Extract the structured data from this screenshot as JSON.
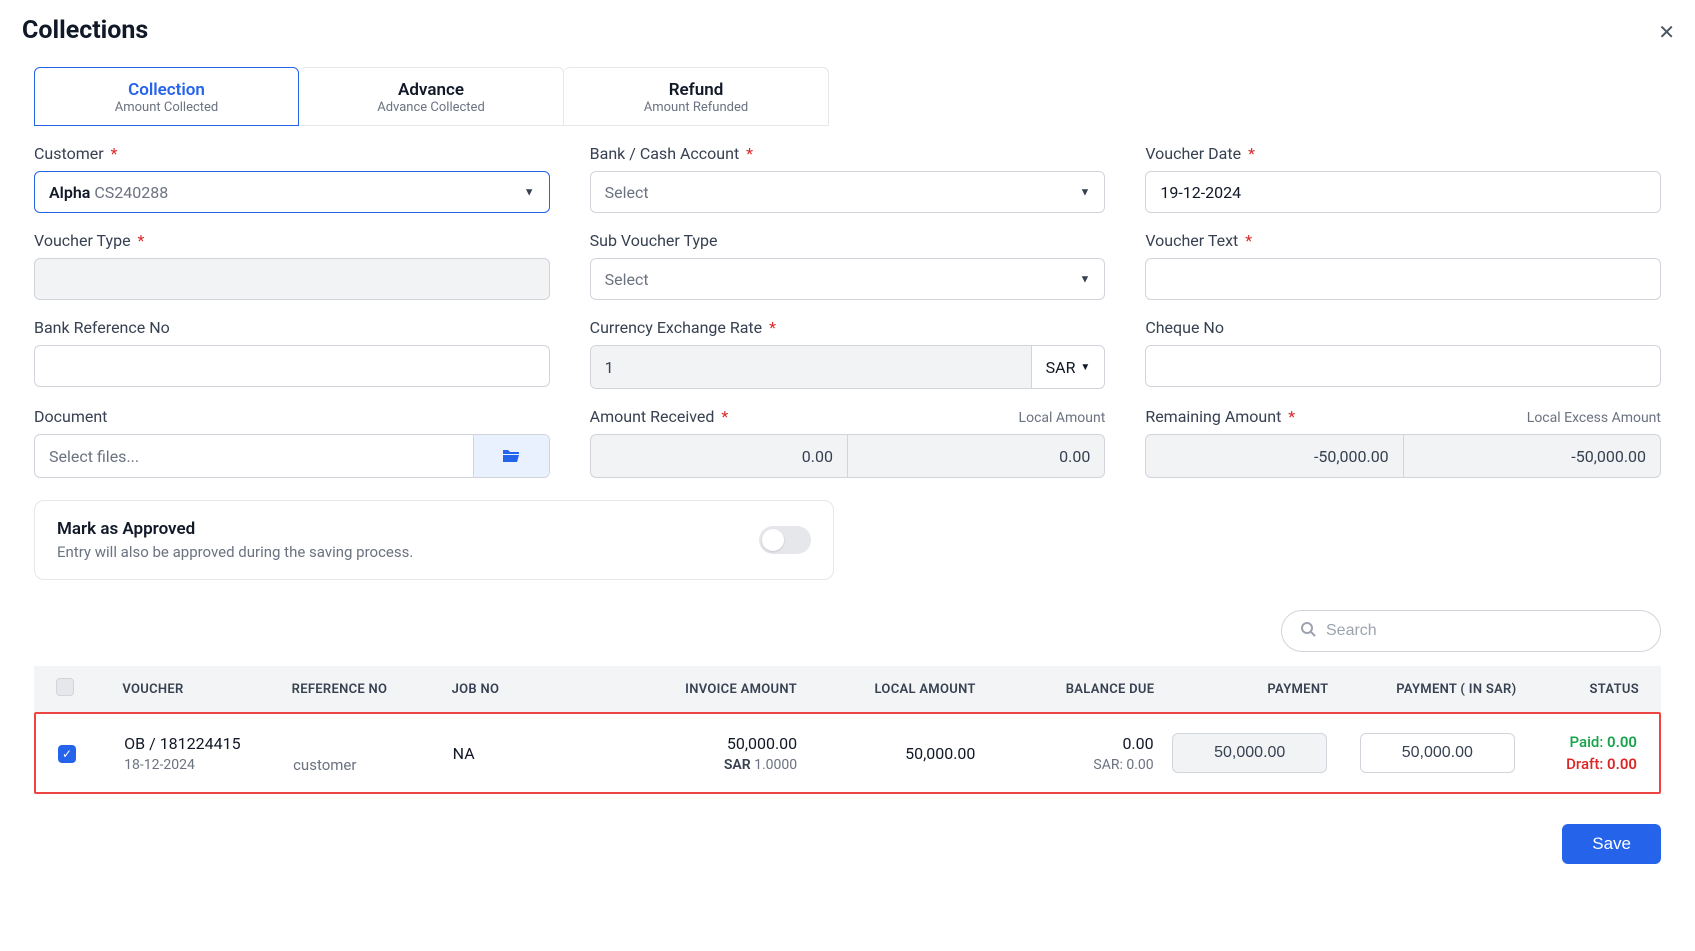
{
  "title": "Collections",
  "tabs": [
    {
      "title": "Collection",
      "sub": "Amount Collected"
    },
    {
      "title": "Advance",
      "sub": "Advance Collected"
    },
    {
      "title": "Refund",
      "sub": "Amount Refunded"
    }
  ],
  "form": {
    "customer": {
      "label": "Customer",
      "name": "Alpha",
      "code": "CS240288"
    },
    "bankAccount": {
      "label": "Bank / Cash Account",
      "placeholder": "Select"
    },
    "voucherDate": {
      "label": "Voucher Date",
      "value": "19-12-2024"
    },
    "voucherType": {
      "label": "Voucher Type"
    },
    "subVoucherType": {
      "label": "Sub Voucher Type",
      "placeholder": "Select"
    },
    "voucherText": {
      "label": "Voucher Text"
    },
    "bankRef": {
      "label": "Bank Reference No"
    },
    "currencyRate": {
      "label": "Currency Exchange Rate",
      "value": "1",
      "currency": "SAR"
    },
    "chequeNo": {
      "label": "Cheque No"
    },
    "document": {
      "label": "Document",
      "placeholder": "Select files..."
    },
    "amountReceived": {
      "label": "Amount Received",
      "labelRight": "Local Amount",
      "v1": "0.00",
      "v2": "0.00"
    },
    "remaining": {
      "label": "Remaining Amount",
      "labelRight": "Local Excess Amount",
      "v1": "-50,000.00",
      "v2": "-50,000.00"
    }
  },
  "approve": {
    "title": "Mark as Approved",
    "sub": "Entry will also be approved during the saving process."
  },
  "search": {
    "placeholder": "Search"
  },
  "tableHead": {
    "voucher": "VOUCHER",
    "reference": "REFERENCE NO",
    "job": "JOB NO",
    "invoice": "INVOICE AMOUNT",
    "local": "LOCAL AMOUNT",
    "balance": "BALANCE DUE",
    "payment": "PAYMENT",
    "paymentSar": "PAYMENT ( IN SAR)",
    "status": "STATUS"
  },
  "row": {
    "voucher": "OB / 181224415",
    "date": "18-12-2024",
    "reference": "customer",
    "job": "NA",
    "invoiceAmount": "50,000.00",
    "invoiceCurrency": "SAR",
    "invoiceRate": "1.0000",
    "localAmount": "50,000.00",
    "balanceDue": "0.00",
    "balanceSar": "SAR: 0.00",
    "payment": "50,000.00",
    "paymentSar": "50,000.00",
    "paidLabel": "Paid:",
    "paidValue": "0.00",
    "draftLabel": "Draft:",
    "draftValue": "0.00"
  },
  "saveButton": "Save"
}
